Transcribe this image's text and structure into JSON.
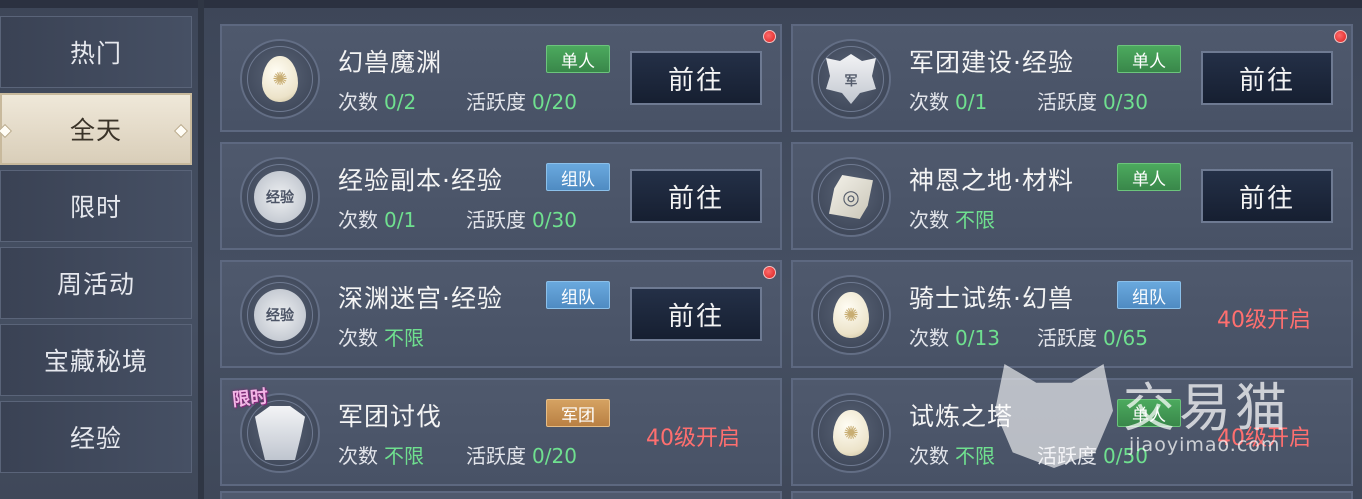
{
  "sidebar": {
    "items": [
      {
        "label": "热门"
      },
      {
        "label": "全天"
      },
      {
        "label": "限时"
      },
      {
        "label": "周活动"
      },
      {
        "label": "宝藏秘境"
      },
      {
        "label": "经验"
      }
    ],
    "selected": "全天"
  },
  "labels": {
    "count": "次数",
    "activity": "活跃度",
    "go": "前往"
  },
  "activities": [
    {
      "title": "幻兽魔渊",
      "badge": "单人",
      "count": "0/2",
      "activity": "0/20",
      "icon": "egg-icon",
      "status": "前往",
      "notify": true
    },
    {
      "title": "军团建设·经验",
      "badge": "单人",
      "count": "0/1",
      "activity": "0/30",
      "icon": "legion-crest-icon",
      "icon_text": "军",
      "status": "前往",
      "notify": true
    },
    {
      "title": "经验副本·经验",
      "badge": "组队",
      "count": "0/1",
      "activity": "0/30",
      "icon": "exp-medal-icon",
      "icon_text": "经验",
      "status": "前往",
      "notify": false
    },
    {
      "title": "神恩之地·材料",
      "badge": "单人",
      "count": "不限",
      "icon": "rune-stone-icon",
      "status": "前往",
      "notify": false
    },
    {
      "title": "深渊迷宫·经验",
      "badge": "组队",
      "count": "不限",
      "icon": "exp-medal-icon",
      "icon_text": "经验",
      "status": "前往",
      "notify": true
    },
    {
      "title": "骑士试练·幻兽",
      "badge": "组队",
      "count": "0/13",
      "activity": "0/65",
      "icon": "egg-icon",
      "locked_text": "40级开启",
      "notify": false
    },
    {
      "title": "军团讨伐",
      "badge": "军团",
      "count": "不限",
      "activity": "0/20",
      "icon": "armor-icon",
      "limited_tag": "限时",
      "locked_text": "40级开启",
      "notify": false
    },
    {
      "title": "试炼之塔",
      "badge": "单人",
      "count": "不限",
      "activity": "0/50",
      "icon": "egg-icon",
      "locked_text": "40级开启",
      "notify": false
    }
  ],
  "colors": {
    "single_badge": "#4caa5e",
    "team_badge": "#6aa9de",
    "legion_badge": "#d5a262",
    "value_green": "#6fe08f",
    "locked_red": "#ff6f6f"
  },
  "watermark": {
    "text": "交易猫",
    "url": "jiaoyimao.com"
  }
}
